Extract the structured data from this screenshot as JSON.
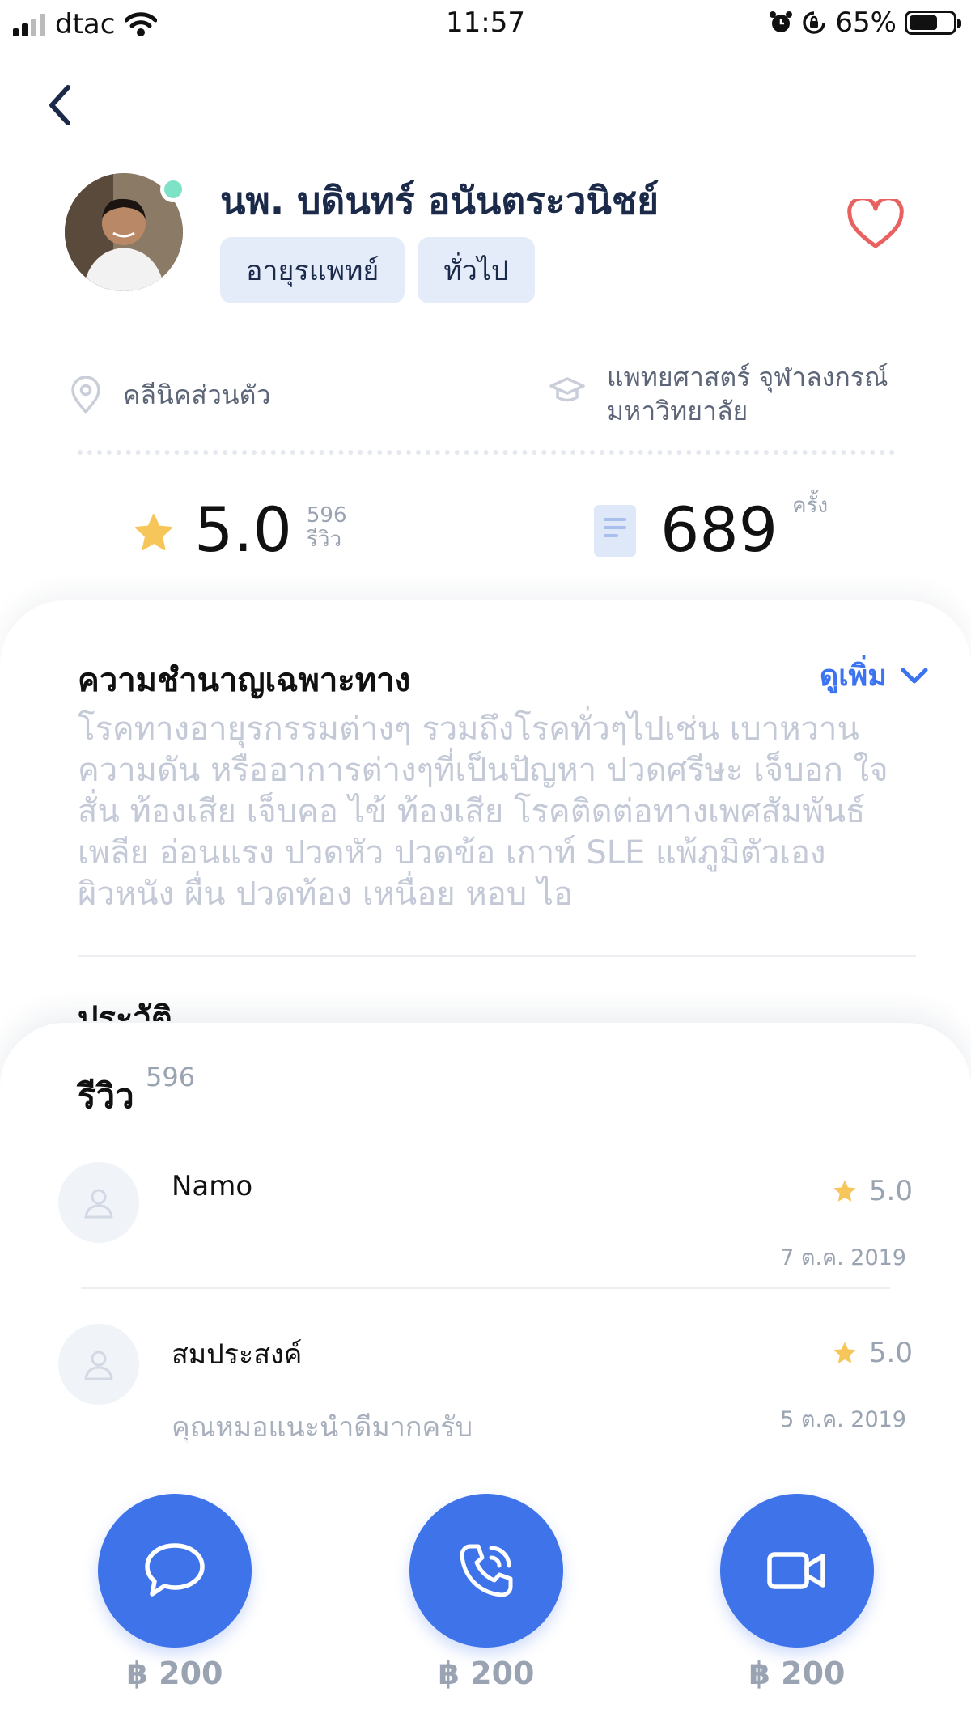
{
  "status_bar": {
    "carrier": "dtac",
    "time": "11:57",
    "battery": "65%"
  },
  "doctor": {
    "name": "นพ. บดินทร์ อนันตระวนิชย์",
    "tags": [
      "อายุรแพทย์",
      "ทั่วไป"
    ],
    "location": "คลีนิคส่วนตัว",
    "education_line1": "แพทยศาสตร์ จุฬาลงกรณ์",
    "education_line2": "มหาวิทยาลัย",
    "rating": "5.0",
    "review_count": "596",
    "review_unit": "รีวิว",
    "consult_count": "689",
    "consult_unit": "ครั้ง"
  },
  "expertise": {
    "title": "ความชำนาญเฉพาะทาง",
    "see_more": "ดูเพิ่ม",
    "text": "โรคทางอายุรกรรมต่างๆ รวมถึงโรคทั่วๆไปเช่น เบาหวาน ความดัน หรืออาการต่างๆที่เป็นปัญหา  ปวดศรีษะ เจ็บอก ใจสั่น ท้องเสีย เจ็บคอ ไข้ ท้องเสีย  โรคติดต่อทางเพศสัมพันธ์ เพลีย อ่อนแรง ปวดหัว  ปวดข้อ เกาท์ SLE แพ้ภูมิตัวเอง ผิวหนัง ผื่น ปวดท้อง เหนื่อย หอบ ไอ",
    "history_title": "ประวัติ"
  },
  "reviews": {
    "title": "รีวิว",
    "count": "596",
    "items": [
      {
        "name": "Namo",
        "comment": "",
        "rating": "5.0",
        "date": "7 ต.ค. 2019"
      },
      {
        "name": "สมประสงค์",
        "comment": "คุณหมอแนะนำดีมากครับ",
        "rating": "5.0",
        "date": "5 ต.ค. 2019"
      }
    ]
  },
  "actions": [
    {
      "icon": "chat-icon",
      "price": "฿ 200"
    },
    {
      "icon": "phone-icon",
      "price": "฿ 200"
    },
    {
      "icon": "video-icon",
      "price": "฿ 200"
    }
  ],
  "colors": {
    "accent": "#3f73ea",
    "online": "#7ee3c6",
    "heart": "#e8625f",
    "star": "#f7c65a"
  }
}
